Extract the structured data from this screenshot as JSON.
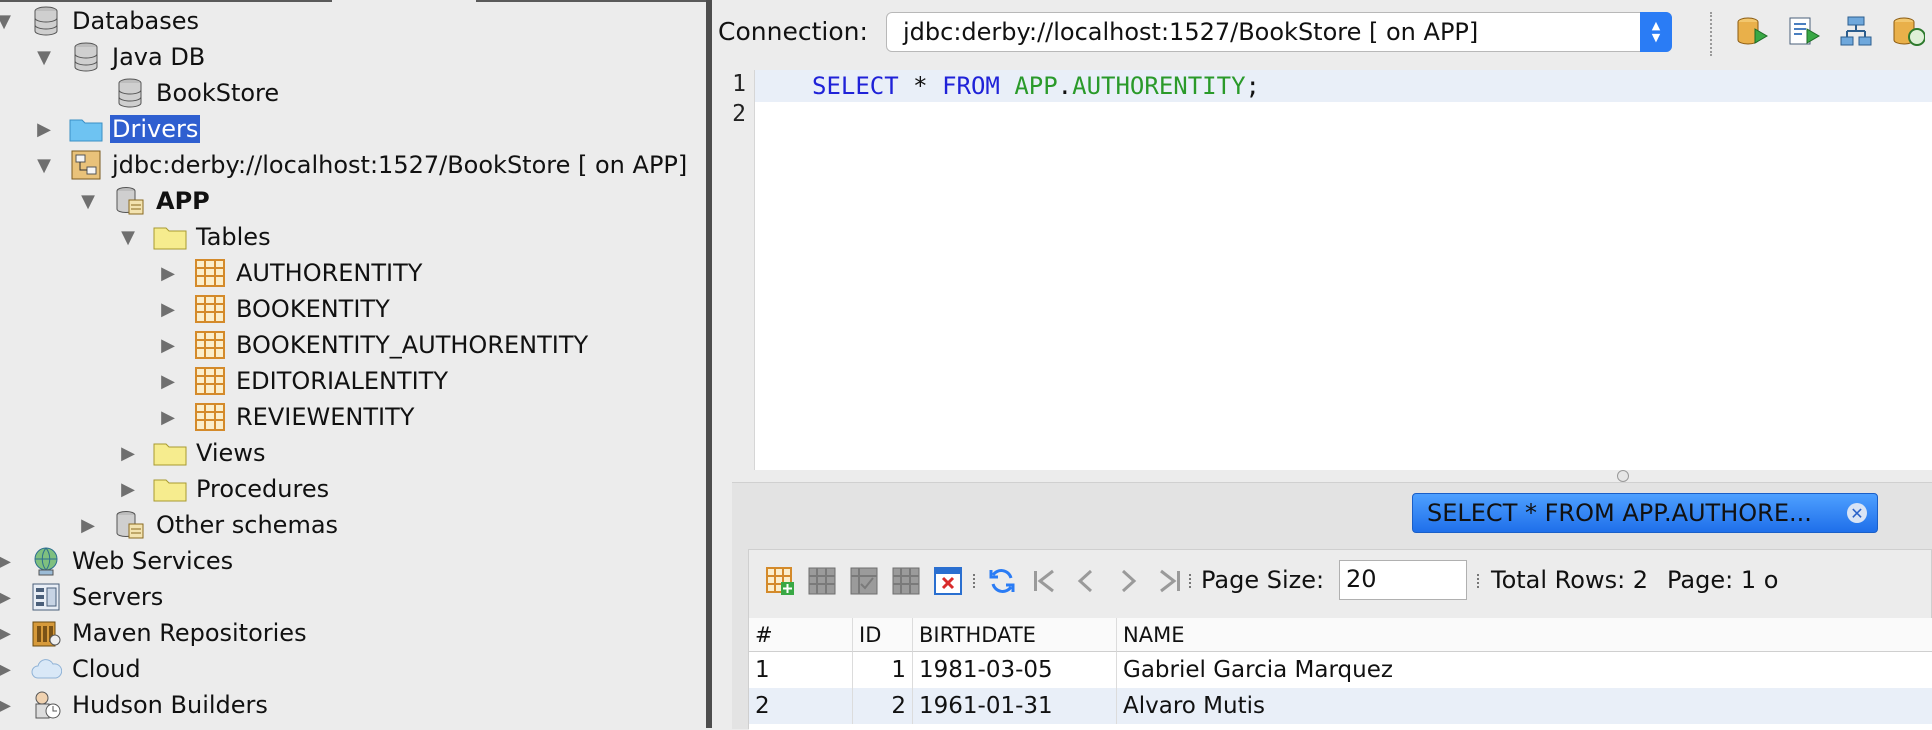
{
  "tree": {
    "databases": "Databases",
    "java_db": "Java DB",
    "bookstore": "BookStore",
    "drivers": "Drivers",
    "connection": "jdbc:derby://localhost:1527/BookStore [ on APP]",
    "app": "APP",
    "tables": "Tables",
    "table_items": [
      "AUTHORENTITY",
      "BOOKENTITY",
      "BOOKENTITY_AUTHORENTITY",
      "EDITORIALENTITY",
      "REVIEWENTITY"
    ],
    "views": "Views",
    "procedures": "Procedures",
    "other_schemas": "Other schemas",
    "web_services": "Web Services",
    "servers": "Servers",
    "maven": "Maven Repositories",
    "cloud": "Cloud",
    "hudson": "Hudson Builders"
  },
  "toolbar": {
    "connection_label": "Connection:",
    "connection_value": "jdbc:derby://localhost:1527/BookStore [ on APP]"
  },
  "editor": {
    "line_numbers": [
      "1",
      "2"
    ],
    "tokens": {
      "select": "SELECT",
      "star": " * ",
      "from": "FROM",
      "space": " ",
      "schema": "APP",
      "dot": ".",
      "table": "AUTHORENTITY",
      "semi": ";"
    }
  },
  "results": {
    "tab_label": "SELECT * FROM APP.AUTHORE...",
    "page_size_label": "Page Size:",
    "page_size_value": "20",
    "total_rows_label": "Total Rows: 2",
    "page_label": "Page: 1 o",
    "columns": [
      "#",
      "ID",
      "BIRTHDATE",
      "NAME"
    ],
    "rows": [
      [
        "1",
        "1",
        "1981-03-05",
        "Gabriel Garcia Marquez"
      ],
      [
        "2",
        "2",
        "1961-01-31",
        "Alvaro Mutis"
      ]
    ]
  },
  "colors": {
    "selection": "#2f5fd0",
    "keyword": "#1f22d8",
    "identifier": "#2a9a2a",
    "tab_blue": "#1f6fea"
  }
}
